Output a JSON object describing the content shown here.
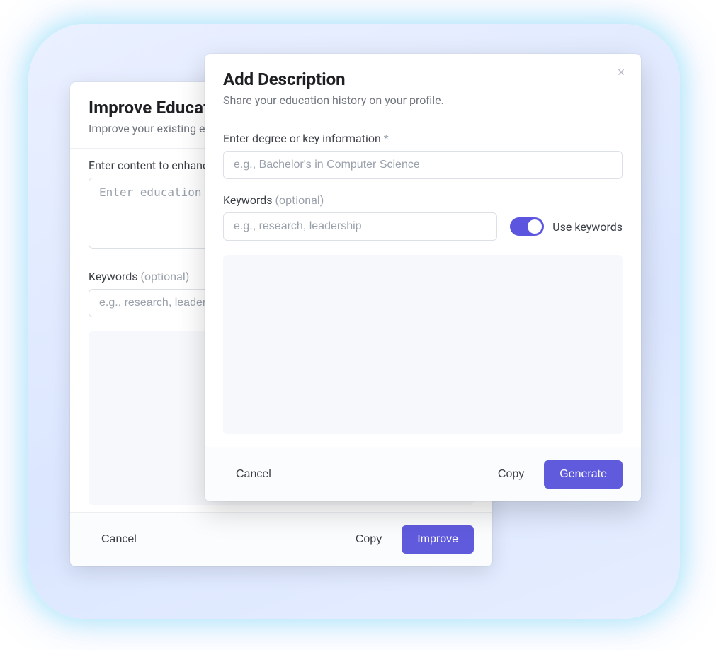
{
  "back": {
    "title": "Improve Education Description",
    "subtitle": "Improve your existing education description.",
    "content_label": "Enter content to enhance",
    "content_required_mark": "*",
    "content_placeholder": "Enter education description to improve",
    "keywords_label": "Keywords",
    "keywords_optional": "(optional)",
    "keywords_placeholder": "e.g., research, leadership",
    "footer": {
      "cancel": "Cancel",
      "copy": "Copy",
      "primary": "Improve"
    }
  },
  "front": {
    "title": "Add Description",
    "subtitle": "Share your education history on your profile.",
    "degree_label": "Enter degree or key information",
    "degree_required_mark": "*",
    "degree_placeholder": "e.g., Bachelor's in Computer Science",
    "keywords_label": "Keywords",
    "keywords_optional": "(optional)",
    "keywords_placeholder": "e.g., research, leadership",
    "use_keywords_label": "Use keywords",
    "footer": {
      "cancel": "Cancel",
      "copy": "Copy",
      "primary": "Generate"
    }
  },
  "colors": {
    "primary": "#605bdd"
  }
}
